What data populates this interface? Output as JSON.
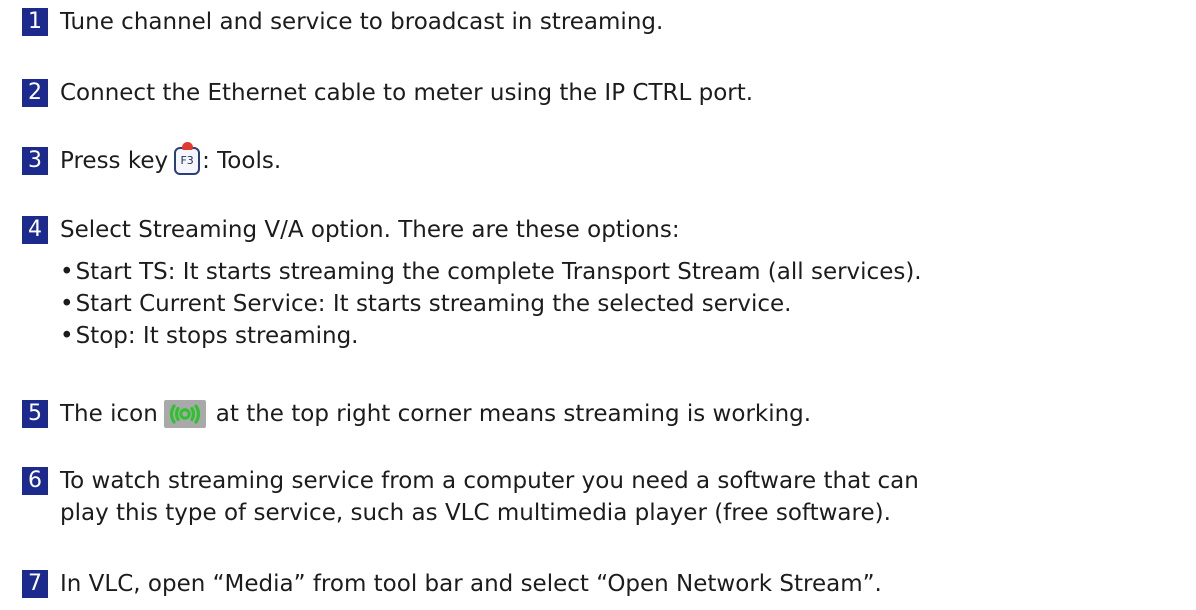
{
  "steps": [
    {
      "number": "1",
      "text": "Tune channel and service to broadcast in streaming."
    },
    {
      "number": "2",
      "text": "Connect the Ethernet cable to meter using the IP CTRL port."
    },
    {
      "number": "3",
      "text_before": "Press key",
      "key_label": "F3",
      "text_after": ": Tools."
    },
    {
      "number": "4",
      "text": "Select Streaming V/A option. There are these options:",
      "bullets": [
        "Start TS: It starts streaming the complete Transport Stream (all services).",
        "Start Current Service: It starts streaming the selected service.",
        "Stop: It stops streaming."
      ]
    },
    {
      "number": "5",
      "text_before": "The icon",
      "text_after": "at the top right corner means streaming is working."
    },
    {
      "number": "6",
      "line1": "To watch streaming service from a computer you need a software that can",
      "line2": "play this type of service, such as VLC multimedia player (free software)."
    },
    {
      "number": "7",
      "text": "In VLC, open “Media” from tool bar and select “Open Network Stream”."
    }
  ],
  "icons": {
    "key_icon": "f3-key-icon",
    "stream_icon": "streaming-icon",
    "stream_color": "#2ec22e"
  },
  "colors": {
    "number_badge_bg": "#1b2a8c",
    "number_badge_fg": "#ffffff"
  }
}
